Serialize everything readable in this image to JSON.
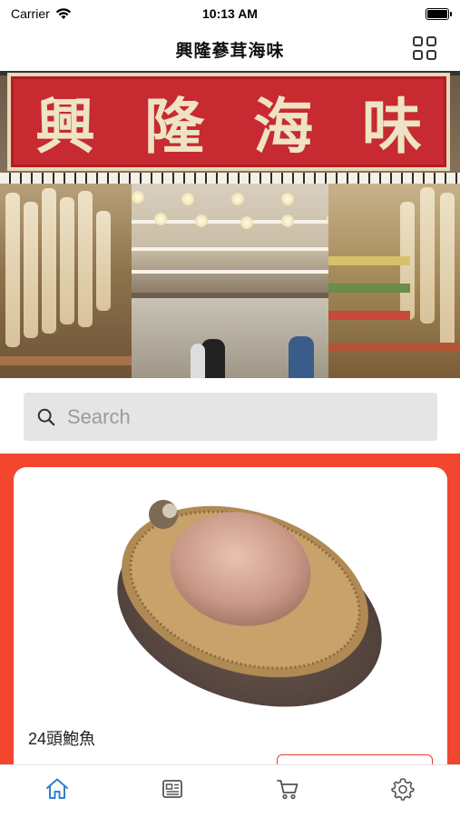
{
  "status_bar": {
    "carrier": "Carrier",
    "time": "10:13 AM"
  },
  "nav": {
    "title": "興隆蔘茸海味",
    "menu_icon": "grid-icon"
  },
  "hero": {
    "sign_text": [
      "興",
      "隆",
      "海",
      "味"
    ]
  },
  "search": {
    "placeholder": "Search",
    "icon": "search-icon"
  },
  "product": {
    "name": "24頭鮑魚"
  },
  "tab_bar": {
    "items": [
      {
        "icon": "home-icon",
        "active": true
      },
      {
        "icon": "news-icon",
        "active": false
      },
      {
        "icon": "cart-icon",
        "active": false
      },
      {
        "icon": "settings-icon",
        "active": false
      }
    ]
  },
  "colors": {
    "accent": "#f2462e",
    "tab_active": "#2f80d1",
    "tab_inactive": "#555555",
    "search_bg": "#e5e5e6"
  }
}
